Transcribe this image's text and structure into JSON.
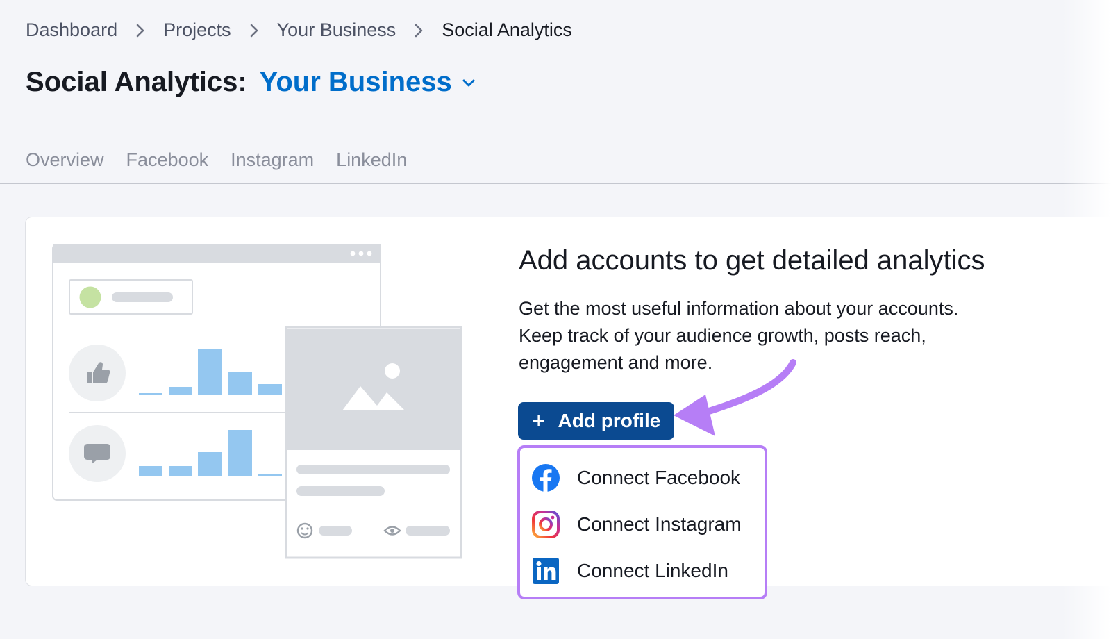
{
  "breadcrumb": {
    "items": [
      "Dashboard",
      "Projects",
      "Your Business"
    ],
    "current": "Social Analytics"
  },
  "header": {
    "title_static": "Social Analytics:",
    "project_name": "Your Business"
  },
  "tabs": [
    "Overview",
    "Facebook",
    "Instagram",
    "LinkedIn"
  ],
  "card": {
    "heading": "Add accounts to get detailed analytics",
    "description_lines": [
      "Get the most useful information about your accounts.",
      "Keep track of your audience growth, posts reach,",
      "engagement and more."
    ],
    "add_button": {
      "icon": "plus-icon",
      "label": "Add profile"
    }
  },
  "dropdown": [
    {
      "label": "Connect Facebook",
      "icon": "facebook-icon"
    },
    {
      "label": "Connect Instagram",
      "icon": "instagram-icon"
    },
    {
      "label": "Connect LinkedIn",
      "icon": "linkedin-icon"
    }
  ],
  "colors": {
    "accent_blue": "#006dca",
    "button_navy": "#0b4a91",
    "highlight_purple": "#b67ef6",
    "page_background": "#f4f5f9"
  }
}
